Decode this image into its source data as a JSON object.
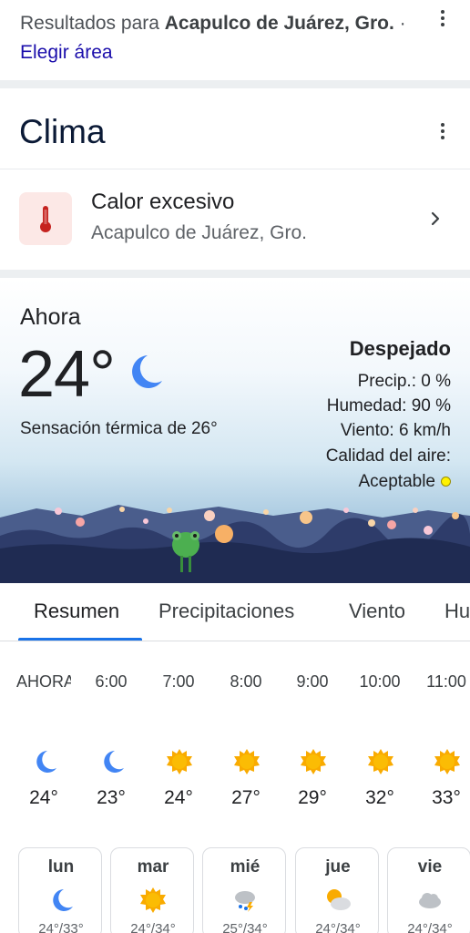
{
  "results": {
    "prefix": "Resultados para ",
    "location": "Acapulco de Juárez, Gro.",
    "separator": " · ",
    "area_link": "Elegir área"
  },
  "weather": {
    "title": "Clima",
    "alert": {
      "title": "Calor excesivo",
      "subtitle": "Acapulco de Juárez, Gro."
    },
    "now": {
      "label": "Ahora",
      "temperature": "24°",
      "icon": "moon-icon",
      "feels_like": "Sensación térmica de 26°",
      "condition": "Despejado",
      "precip": "Precip.: 0 %",
      "humidity": "Humedad: 90 %",
      "wind": "Viento: 6 km/h",
      "air_quality_label": "Calidad del aire:",
      "air_quality_value": "Aceptable",
      "air_quality_color": "#fff200"
    },
    "tabs": [
      "Resumen",
      "Precipitaciones",
      "Viento",
      "Hu"
    ],
    "hourly": [
      {
        "time": "AHORA",
        "icon": "moon-icon",
        "temp": "24°"
      },
      {
        "time": "6:00",
        "icon": "moon-icon",
        "temp": "23°"
      },
      {
        "time": "7:00",
        "icon": "sun-icon",
        "temp": "24°"
      },
      {
        "time": "8:00",
        "icon": "sun-icon",
        "temp": "27°"
      },
      {
        "time": "9:00",
        "icon": "sun-icon",
        "temp": "29°"
      },
      {
        "time": "10:00",
        "icon": "sun-icon",
        "temp": "32°"
      },
      {
        "time": "11:00",
        "icon": "sun-icon",
        "temp": "33°"
      }
    ],
    "daily": [
      {
        "day": "lun",
        "icon": "moon-icon",
        "range": "24°/33°"
      },
      {
        "day": "mar",
        "icon": "sun-icon",
        "range": "24°/34°"
      },
      {
        "day": "mié",
        "icon": "thunderstorm-icon",
        "range": "25°/34°"
      },
      {
        "day": "jue",
        "icon": "partly-cloudy-icon",
        "range": "24°/34°"
      },
      {
        "day": "vie",
        "icon": "cloud-icon",
        "range": "24°/34°"
      }
    ]
  },
  "colors": {
    "accent": "#1a73e8",
    "link": "#1a0dab",
    "sun": "#f9ab00",
    "moon": "#4285f4",
    "alert_bg": "#fce8e6",
    "alert_icon": "#c5221f"
  }
}
